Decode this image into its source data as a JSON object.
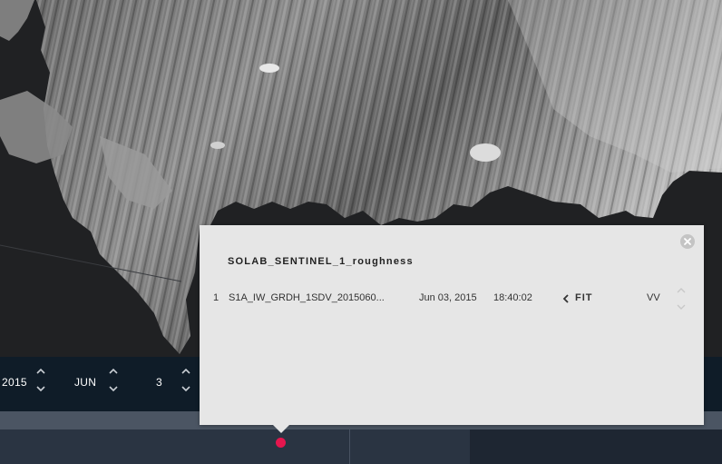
{
  "date_selector": {
    "year": "2015",
    "month": "JUN",
    "day": "3"
  },
  "popup": {
    "layer_title": "SOLAB_SENTINEL_1_roughness",
    "granule": {
      "index": "1",
      "name": "S1A_IW_GRDH_1SDV_2015060...",
      "date": "Jun 03, 2015",
      "time": "18:40:02",
      "fit_label": "FIT",
      "polarization": "VV"
    }
  },
  "colors": {
    "popup_background": "#e6e6e6",
    "date_bar": "#0f1c28",
    "timeline": "#2a3442",
    "marker": "#e5164e"
  },
  "icons": {
    "close": "close-circle-icon",
    "fit": "chevron-left-icon",
    "spinner_up": "chevron-up-icon",
    "spinner_down": "chevron-down-icon"
  }
}
